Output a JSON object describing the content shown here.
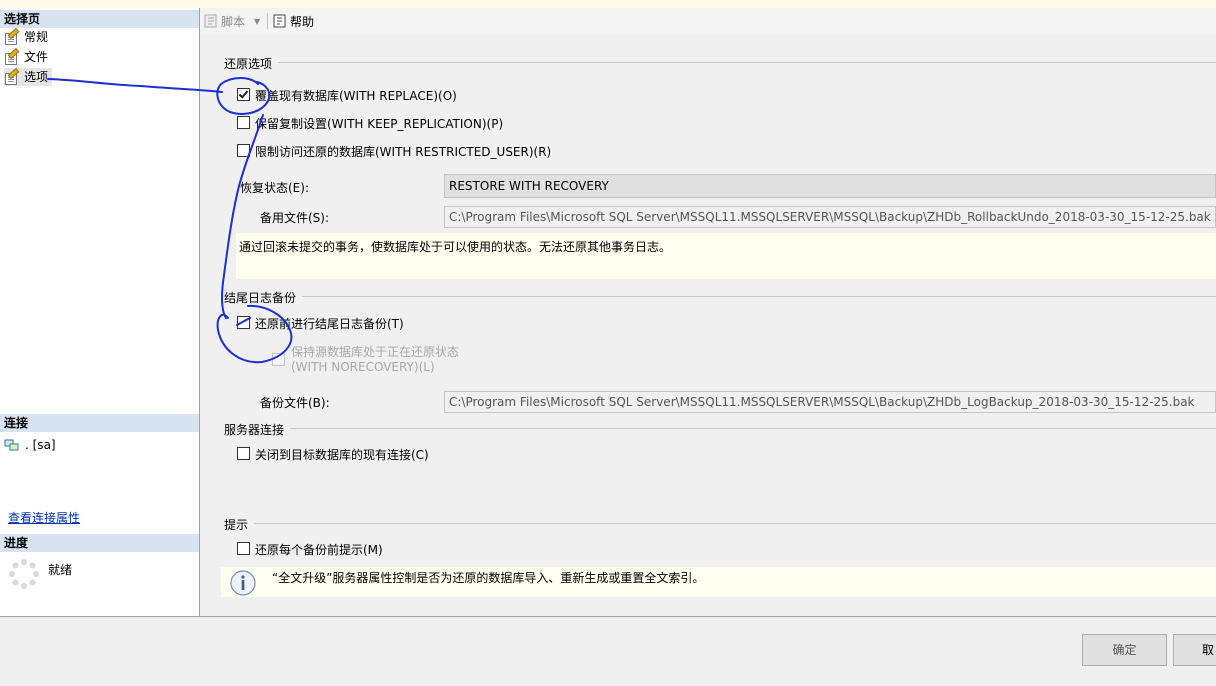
{
  "left_pane": {
    "select_page_header": "选择页",
    "pages": [
      {
        "label": "常规"
      },
      {
        "label": "文件"
      },
      {
        "label": "选项"
      }
    ],
    "connection_header": "连接",
    "connection_value": ". [sa]",
    "view_connection_link": "查看连接属性",
    "progress_header": "进度",
    "progress_status": "就绪"
  },
  "toolbar": {
    "script_label": "脚本",
    "help_label": "帮助"
  },
  "restore_options": {
    "title": "还原选项",
    "overwrite_label": "覆盖现有数据库(WITH REPLACE)(O)",
    "keep_replication_label": "保留复制设置(WITH KEEP_REPLICATION)(P)",
    "restricted_user_label": "限制访问还原的数据库(WITH RESTRICTED_USER)(R)",
    "recovery_state_label": "恢复状态(E):",
    "recovery_state_value": "RESTORE WITH RECOVERY",
    "standby_file_label": "备用文件(S):",
    "standby_file_value": "C:\\Program Files\\Microsoft SQL Server\\MSSQL11.MSSQLSERVER\\MSSQL\\Backup\\ZHDb_RollbackUndo_2018-03-30_15-12-25.bak",
    "recovery_note": "通过回滚未提交的事务，使数据库处于可以使用的状态。无法还原其他事务日志。"
  },
  "tail_log": {
    "title": "结尾日志备份",
    "tail_backup_label": "还原前进行结尾日志备份(T)",
    "norecovery_line1": "保持源数据库处于正在还原状态",
    "norecovery_line2": "(WITH NORECOVERY)(L)",
    "backup_file_label": "备份文件(B):",
    "backup_file_value": "C:\\Program Files\\Microsoft SQL Server\\MSSQL11.MSSQLSERVER\\MSSQL\\Backup\\ZHDb_LogBackup_2018-03-30_15-12-25.bak"
  },
  "server_connections": {
    "title": "服务器连接",
    "close_connections_label": "关闭到目标数据库的现有连接(C)"
  },
  "prompt": {
    "title": "提示",
    "prompt_each_label": "还原每个备份前提示(M)",
    "info_text": "“全文升级”服务器属性控制是否为还原的数据库导入、重新生成或重置全文索引。"
  },
  "checkbox_state": {
    "overwrite": true,
    "keep_replication": false,
    "restricted_user": false,
    "tail_backup": false,
    "norecovery": false,
    "close_connections": false,
    "prompt_each": false
  },
  "buttons": {
    "ok_label": "确定",
    "cancel_label": "取"
  },
  "annotation_color": "#1a2fd6"
}
